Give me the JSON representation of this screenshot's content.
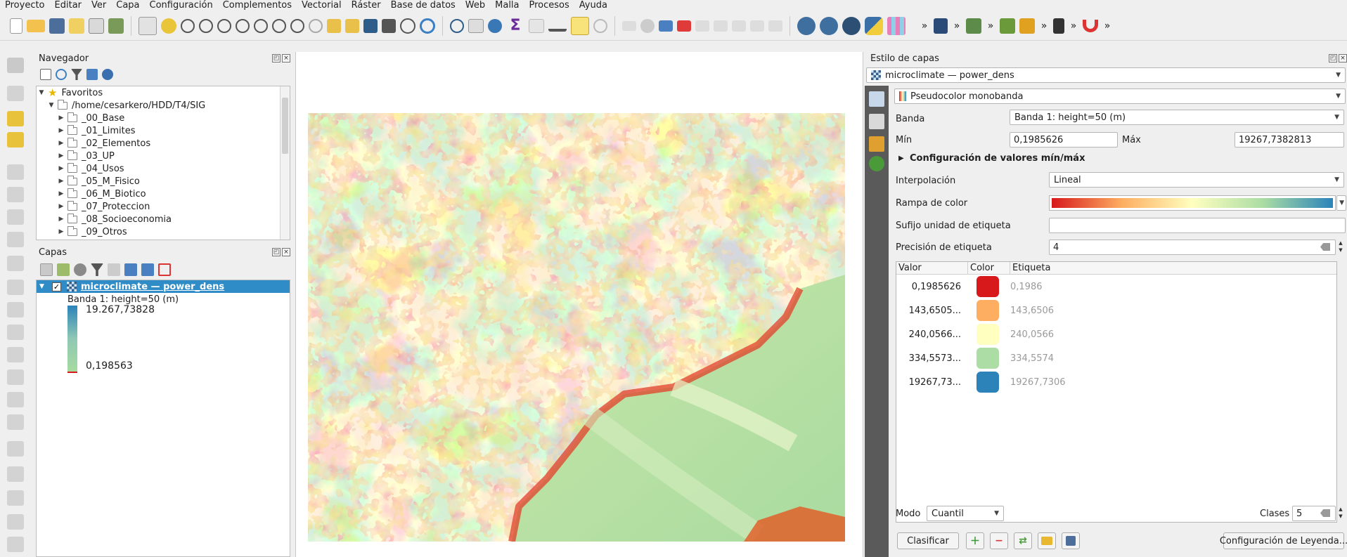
{
  "menu": [
    "Proyecto",
    "Editar",
    "Ver",
    "Capa",
    "Configuración",
    "Complementos",
    "Vectorial",
    "Ráster",
    "Base de datos",
    "Web",
    "Malla",
    "Procesos",
    "Ayuda"
  ],
  "toolbar": {
    "icons": [
      "new-project-icon",
      "open-project-icon",
      "save-project-icon",
      "print-layout-icon",
      "layout-manager-icon",
      "style-manager-icon",
      "pan-icon",
      "pan-to-selection-icon",
      "zoom-in-icon",
      "zoom-out-icon",
      "zoom-full-icon",
      "zoom-to-selection-icon",
      "zoom-to-layer-icon",
      "zoom-native-icon",
      "zoom-last-icon",
      "zoom-next-icon",
      "new-bookmark-icon",
      "show-bookmarks-icon",
      "new-map-view-icon",
      "new-3d-view-icon",
      "temporal-controller-icon",
      "refresh-icon",
      "identify-icon",
      "attribute-table-icon",
      "statistics-icon",
      "sum-icon",
      "measure-icon",
      "map-tips-icon",
      "label-icon",
      "python-icon",
      "help-icon",
      "plugin-icon",
      "magnet-icon"
    ],
    "overflow": "»"
  },
  "navigator": {
    "title": "Navegador",
    "favorites": "Favoritos",
    "path": "/home/cesarkero/HDD/T4/SIG",
    "folders": [
      "_00_Base",
      "_01_Limites",
      "_02_Elementos",
      "_03_UP",
      "_04_Usos",
      "_05_M_Fisico",
      "_06_M_Biotico",
      "_07_Proteccion",
      "_08_Socioeconomia",
      "_09_Otros"
    ]
  },
  "layers": {
    "title": "Capas",
    "layer_name": "microclimate — power_dens",
    "band": "Banda 1: height=50 (m)",
    "max": "19.267,73828",
    "min": "0,198563",
    "checked": true
  },
  "style": {
    "title": "Estilo de capas",
    "layer_combo": "microclimate — power_dens",
    "renderer": "Pseudocolor monobanda",
    "band_label": "Banda",
    "band_value": "Banda 1: height=50 (m)",
    "min_label": "Mín",
    "min_value": "0,1985626",
    "max_label": "Máx",
    "max_value": "19267,7382813",
    "minmax_section": "Configuración de valores mín/máx",
    "interp_label": "Interpolación",
    "interp_value": "Lineal",
    "ramp_label": "Rampa de color",
    "suffix_label": "Sufijo unidad de etiqueta",
    "suffix_value": "",
    "precision_label": "Precisión de etiqueta",
    "precision_value": "4",
    "col_value": "Valor",
    "col_color": "Color",
    "col_label": "Etiqueta",
    "rows": [
      {
        "value": "0,1985626",
        "color": "#d7191c",
        "label": "0,1986"
      },
      {
        "value": "143,6505...",
        "color": "#fdae61",
        "label": "143,6506"
      },
      {
        "value": "240,0566...",
        "color": "#ffffbf",
        "label": "240,0566"
      },
      {
        "value": "334,5573...",
        "color": "#abdda4",
        "label": "334,5574"
      },
      {
        "value": "19267,73...",
        "color": "#2b83ba",
        "label": "19267,7306"
      }
    ],
    "mode_label": "Modo",
    "mode_value": "Cuantil",
    "classes_label": "Clases",
    "classes_value": "5",
    "classify_button": "Clasificar",
    "legend_button": "Configuración de Leyenda..."
  },
  "colors": {
    "accent": "#308cc6",
    "ramp": [
      "#d7191c",
      "#fdae61",
      "#ffffbf",
      "#abdda4",
      "#2b83ba"
    ]
  }
}
